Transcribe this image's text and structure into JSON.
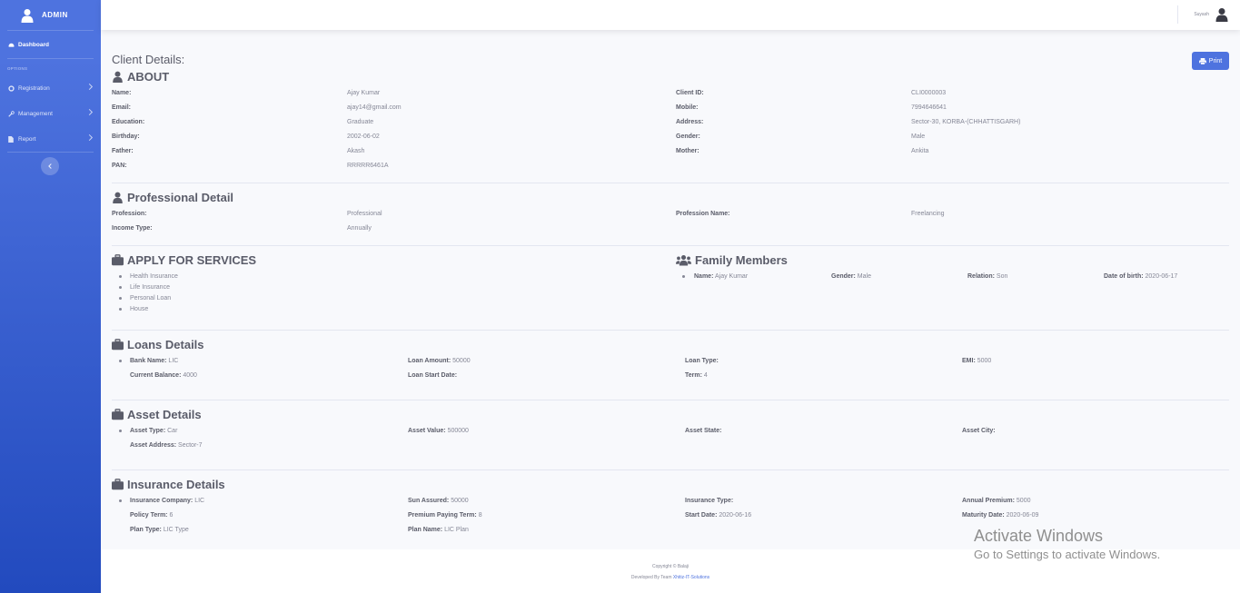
{
  "sidebar": {
    "brand": "ADMIN",
    "dashboard": "Dashboard",
    "options_heading": "OPTIONS",
    "items": [
      {
        "label": "Registration"
      },
      {
        "label": "Management"
      },
      {
        "label": "Report"
      }
    ]
  },
  "topbar": {
    "username": "Suyash"
  },
  "page": {
    "title": "Client Details:",
    "print_label": "Print"
  },
  "about": {
    "title": "ABOUT",
    "left": [
      {
        "label": "Name:",
        "value": "Ajay Kumar"
      },
      {
        "label": "Email:",
        "value": "ajay14@gmail.com"
      },
      {
        "label": "Education:",
        "value": "Graduate"
      },
      {
        "label": "Birthday:",
        "value": "2002-06-02"
      },
      {
        "label": "Father:",
        "value": "Akash"
      },
      {
        "label": "PAN:",
        "value": "RRRRR6461A"
      }
    ],
    "right": [
      {
        "label": "Client ID:",
        "value": "CLI0000003"
      },
      {
        "label": "Mobile:",
        "value": "7994646641"
      },
      {
        "label": "Address:",
        "value": "Sector-30, KORBA-(CHHATTISGARH)"
      },
      {
        "label": "Gender:",
        "value": "Male"
      },
      {
        "label": "Mother:",
        "value": "Ankita"
      }
    ]
  },
  "professional": {
    "title": "Professional Detail",
    "rows": [
      {
        "label": "Profession:",
        "value": "Professional"
      },
      {
        "label": "Income Type:",
        "value": "Annually"
      }
    ],
    "right": {
      "label": "Profession Name:",
      "value": "Freelancing"
    }
  },
  "services": {
    "title": "APPLY FOR SERVICES",
    "items": [
      "Health Insurance",
      "Life Insurance",
      "Personal Loan",
      "House"
    ]
  },
  "family": {
    "title": "Family Members",
    "member": {
      "name_label": "Name:",
      "name": "Ajay Kumar",
      "gender_label": "Gender:",
      "gender": "Male",
      "relation_label": "Relation:",
      "relation": "Son",
      "dob_label": "Date of birth:",
      "dob": "2020-06-17"
    }
  },
  "loans": {
    "title": "Loans Details",
    "fields": [
      {
        "label": "Bank Name:",
        "value": "LIC"
      },
      {
        "label": "Loan Amount:",
        "value": "50000"
      },
      {
        "label": "Loan Type:",
        "value": ""
      },
      {
        "label": "EMI:",
        "value": "5000"
      },
      {
        "label": "Current Balance:",
        "value": "4000"
      },
      {
        "label": "Loan Start Date:",
        "value": ""
      },
      {
        "label": "Term:",
        "value": "4"
      }
    ]
  },
  "assets": {
    "title": "Asset Details",
    "fields": [
      {
        "label": "Asset Type:",
        "value": "Car"
      },
      {
        "label": "Asset Value:",
        "value": "500000"
      },
      {
        "label": "Asset State:",
        "value": ""
      },
      {
        "label": "Asset City:",
        "value": ""
      },
      {
        "label": "Asset Address:",
        "value": "Sector-7"
      }
    ]
  },
  "insurance": {
    "title": "Insurance Details",
    "fields": [
      {
        "label": "Insurance Company:",
        "value": "LIC"
      },
      {
        "label": "Sun Assured:",
        "value": "50000"
      },
      {
        "label": "Insurance Type:",
        "value": ""
      },
      {
        "label": "Annual Premium:",
        "value": "5000"
      },
      {
        "label": "Policy Term:",
        "value": "6"
      },
      {
        "label": "Premium Paying Term:",
        "value": "8"
      },
      {
        "label": "Start Date:",
        "value": "2020-06-16"
      },
      {
        "label": "Maturity Date:",
        "value": "2020-06-09"
      },
      {
        "label": "Plan Type:",
        "value": "LIC Type"
      },
      {
        "label": "Plan Name:",
        "value": "LIC Plan"
      }
    ]
  },
  "footer": {
    "copyright": "Copyright © Balaji",
    "developed_by": "Developed By Team",
    "team": "Xhitiz-IT-Solutions"
  },
  "watermark": {
    "line1": "Activate Windows",
    "line2": "Go to Settings to activate Windows."
  }
}
